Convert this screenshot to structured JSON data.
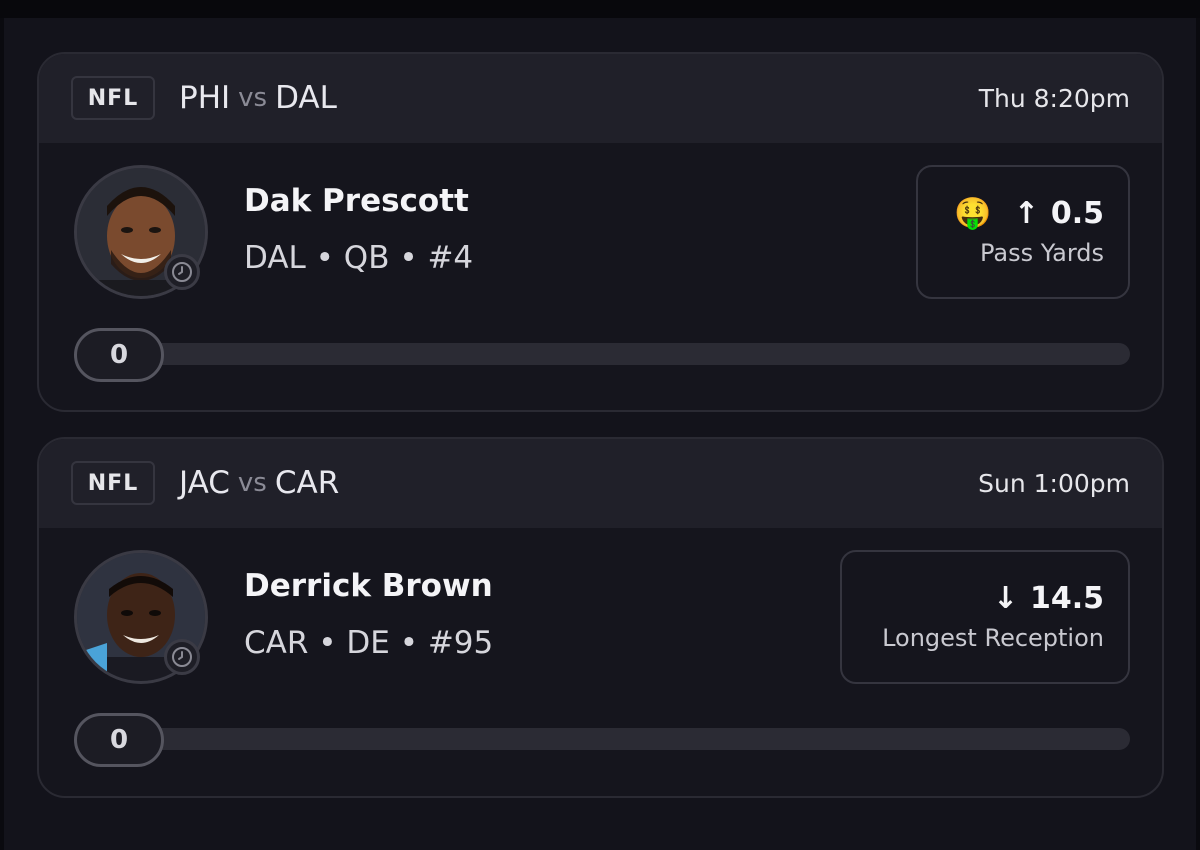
{
  "picks": [
    {
      "league": "NFL",
      "home": "PHI",
      "vs": "vs",
      "away": "DAL",
      "time": "Thu 8:20pm",
      "player": {
        "name": "Dak Prescott",
        "meta": "DAL • QB • #4",
        "avatar": "player-photo"
      },
      "prop": {
        "emoji": "🤑",
        "direction": "up",
        "arrow": "↑",
        "line": "0.5",
        "stat": "Pass Yards"
      },
      "progress": {
        "value": "0",
        "fraction": 0
      }
    },
    {
      "league": "NFL",
      "home": "JAC",
      "vs": "vs",
      "away": "CAR",
      "time": "Sun 1:00pm",
      "player": {
        "name": "Derrick Brown",
        "meta": "CAR • DE • #95",
        "avatar": "player-photo"
      },
      "prop": {
        "direction": "down",
        "arrow": "↓",
        "line": "14.5",
        "stat": "Longest Reception"
      },
      "progress": {
        "value": "0",
        "fraction": 0
      }
    }
  ],
  "colors": {
    "background": "#13131b",
    "card": "#15151d",
    "card_header": "#202029",
    "border": "#2a2a33",
    "track": "#2b2b34",
    "text": "#f2f2f5",
    "muted": "#8b8b96"
  }
}
